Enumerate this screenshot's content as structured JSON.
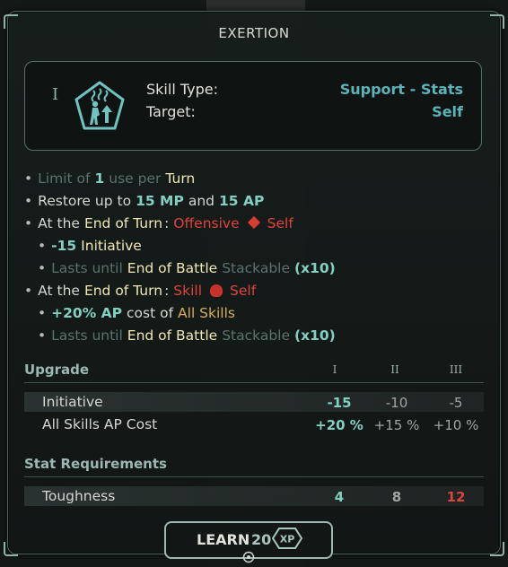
{
  "window": {
    "title": "EXERTION"
  },
  "skill": {
    "rank_glyph": "I",
    "icon": "exertion-figure-arrow-icon",
    "type_label": "Skill Type:",
    "type_value": "Support - Stats",
    "target_label": "Target:",
    "target_value": "Self"
  },
  "description": {
    "line1": {
      "a": "Limit of",
      "b": "1",
      "c": "use per",
      "d": "Turn"
    },
    "line2": {
      "a": "Restore up to",
      "b": "15 MP",
      "c": "and",
      "d": "15 AP"
    },
    "line3": {
      "a": "At the",
      "b": "End of Turn",
      "c": ":",
      "d": "Offensive",
      "e": "Self"
    },
    "line4": {
      "a": "-15",
      "b": "Initiative"
    },
    "line5": {
      "a": "Lasts until",
      "b": "End of Battle",
      "c": "Stackable",
      "d": "(x10)"
    },
    "line6": {
      "a": "At the",
      "b": "End of Turn",
      "c": ":",
      "d": "Skill",
      "e": "Self"
    },
    "line7": {
      "a": "+20% AP",
      "b": "cost of",
      "c": "All Skills"
    },
    "line8": {
      "a": "Lasts until",
      "b": "End of Battle",
      "c": "Stackable",
      "d": "(x10)"
    }
  },
  "upgrade": {
    "title": "Upgrade",
    "ranks": [
      "I",
      "II",
      "III"
    ],
    "rows": [
      {
        "label": "Initiative",
        "values": [
          "-15",
          "-10",
          "-5"
        ]
      },
      {
        "label": "All Skills AP Cost",
        "values": [
          "+20 %",
          "+15 %",
          "+10 %"
        ]
      }
    ]
  },
  "requirements": {
    "title": "Stat Requirements",
    "rows": [
      {
        "label": "Toughness",
        "values": [
          "4",
          "8",
          "12"
        ]
      }
    ]
  },
  "learn": {
    "label": "LEARN",
    "cost": "20",
    "currency": "XP"
  },
  "colors": {
    "accent": "#5cb3b8",
    "good": "#84d0c0",
    "bad": "#e0433a",
    "highlight": "#efe8b4"
  }
}
